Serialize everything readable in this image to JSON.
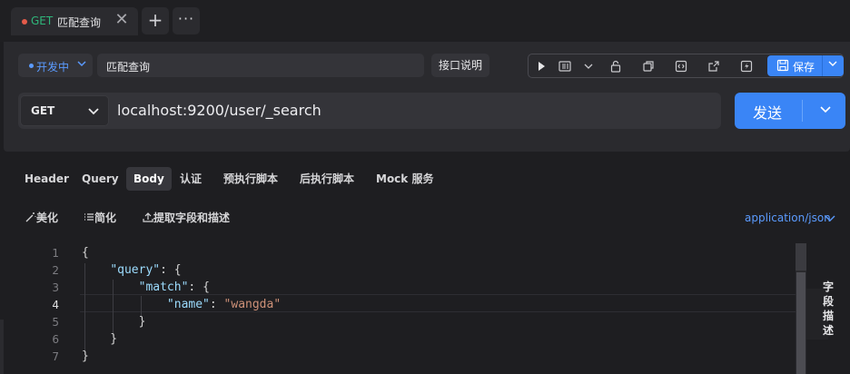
{
  "tab": {
    "method": "GET",
    "title": "匹配查询",
    "close_glyph": "✕",
    "add_glyph": "+",
    "more_glyph": "···"
  },
  "request": {
    "status_label": "开发中",
    "name_value": "匹配查询",
    "doc_button": "接口说明",
    "save_label": "保存",
    "method": "GET",
    "url": "localhost:9200/user/_search",
    "send_label": "发送",
    "toolbar_icons": [
      "play-icon",
      "doc-list-icon",
      "chevron-down-icon",
      "unlock-icon",
      "copy-icon",
      "code-icon",
      "share-icon",
      "flash-icon",
      "save-icon"
    ]
  },
  "body_tabs": {
    "items": [
      "Header",
      "Query",
      "Body",
      "认证",
      "预执行脚本",
      "后执行脚本",
      "Mock 服务"
    ],
    "active": "Body"
  },
  "editor_tools": {
    "beautify": "美化",
    "simplify": "简化",
    "extract": "提取字段和描述",
    "content_type": "application/json"
  },
  "editor": {
    "line_numbers": [
      "1",
      "2",
      "3",
      "4",
      "5",
      "6",
      "7"
    ],
    "current_line": "4",
    "lines": [
      "{",
      "    \"query\": {",
      "        \"match\": {",
      "            \"name\": \"wangda\"",
      "        }",
      "    }",
      "}"
    ]
  },
  "side_panel": {
    "label": "字段描述"
  },
  "colors": {
    "accent": "#3a85f6",
    "get_method": "#2fb67a",
    "status_dot": "#5b9bff",
    "json_key": "#9cdcfe",
    "json_string": "#ce9178"
  }
}
